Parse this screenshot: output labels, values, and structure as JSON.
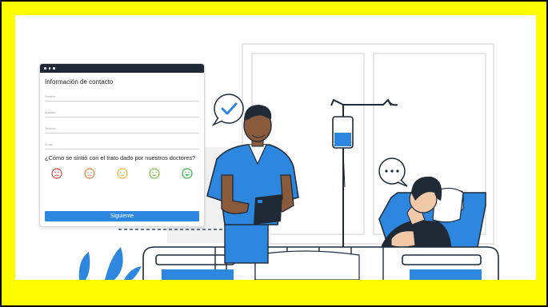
{
  "form": {
    "title": "Información de contacto",
    "fields": [
      {
        "placeholder": "Nombre"
      },
      {
        "placeholder": "Apellido"
      },
      {
        "placeholder": "Teléfono"
      },
      {
        "placeholder": "Email"
      }
    ],
    "question": "¿Cómo se sintió con el trato dado por nuestros doctores?",
    "ratings": [
      {
        "icon": "very-sad-face-icon",
        "color": "#e0463c"
      },
      {
        "icon": "sad-face-icon",
        "color": "#f07b35"
      },
      {
        "icon": "neutral-face-icon",
        "color": "#f2b525"
      },
      {
        "icon": "happy-face-icon",
        "color": "#7cc43a"
      },
      {
        "icon": "very-happy-face-icon",
        "color": "#3fb046"
      }
    ],
    "next_label": "Siguiente"
  },
  "colors": {
    "frame_background": "#fffc00",
    "accent_blue": "#2d87de",
    "dark_navy": "#1f2a36"
  },
  "illustration": {
    "check_bubble_icon": "checkmark-speech-bubble-icon",
    "ellipsis_bubble_icon": "ellipsis-speech-bubble-icon"
  }
}
